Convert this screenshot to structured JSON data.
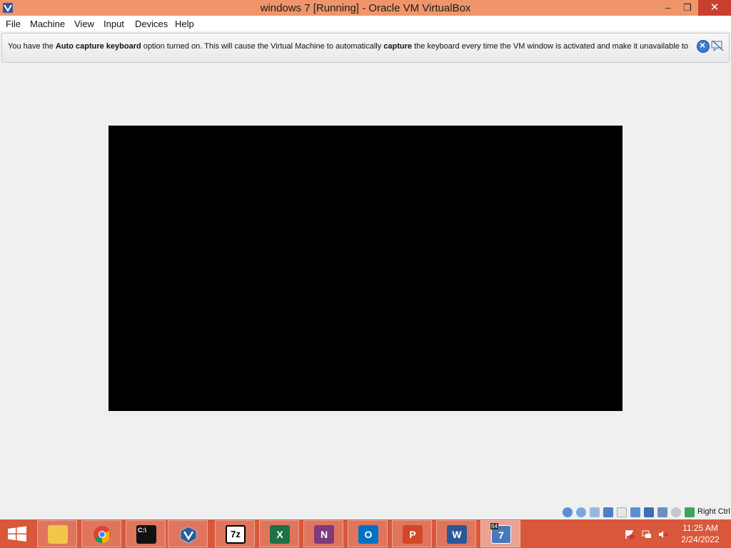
{
  "window": {
    "title": "windows 7 [Running] - Oracle VM VirtualBox",
    "min_glyph": "–",
    "max_glyph": "❐",
    "close_glyph": "✕"
  },
  "menu": {
    "items": [
      "File",
      "Machine",
      "View",
      "Input",
      "Devices",
      "Help"
    ]
  },
  "notice": {
    "part1": "You have the ",
    "bold1": "Auto capture keyboard",
    "part2": " option turned on. This will cause the Virtual Machine to automatically ",
    "bold2": "capture",
    "part3": " the keyboard every time the VM window is activated and make it unavailable to"
  },
  "statusbar": {
    "icons": [
      "hard-disk-icon",
      "optical-drive-icon",
      "audio-icon",
      "network-icon",
      "usb-icon",
      "shared-folders-icon",
      "display-icon",
      "video-capture-icon",
      "virtualization-icon",
      "mouse-integration-icon",
      "host-key-icon"
    ],
    "host_key_label": "Right Ctrl"
  },
  "taskbar": {
    "apps": [
      "File Explorer",
      "Google Chrome",
      "Command Prompt",
      "Oracle VM VirtualBox",
      "7-Zip",
      "Excel",
      "OneNote",
      "Outlook",
      "PowerPoint",
      "Word",
      "windows 7 VM"
    ],
    "seven_zip_label": "7z",
    "excel_label": "X",
    "onenote_label": "N",
    "outlook_label": "O",
    "powerpoint_label": "P",
    "word_label": "W",
    "vm_label": "7",
    "vm_badge": "64",
    "cmd_label": "C:\\",
    "time": "11:25 AM",
    "date": "2/24/2022"
  }
}
